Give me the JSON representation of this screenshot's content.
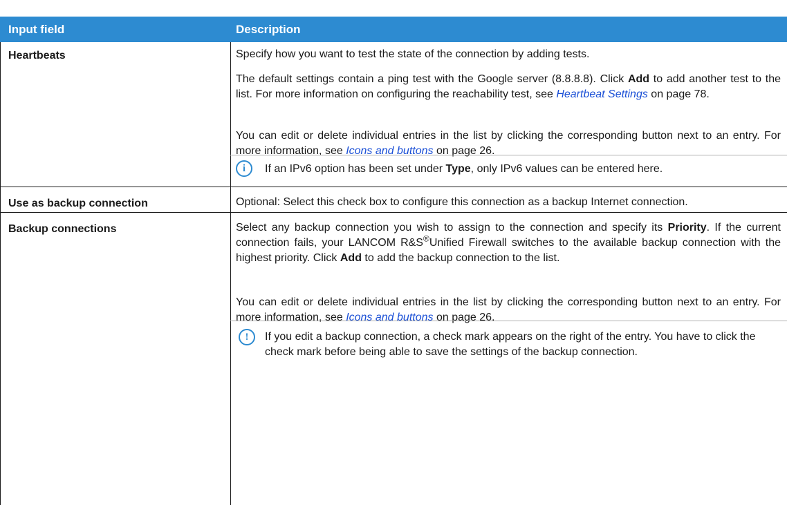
{
  "table": {
    "headers": [
      "Input field",
      "Description"
    ],
    "rows": {
      "heartbeats": {
        "field": "Heartbeats",
        "p1": "Specify how you want to test the state of the connection by adding tests.",
        "p2_a": "The default settings contain a ping test with the Google server (8.8.8.8). Click ",
        "p2_b": "Add",
        "p2_c": " to add another test to the list. For more information on configuring the reachability test, see ",
        "p2_link": "Heartbeat Settings",
        "p2_d": " on page 78.",
        "p3_a": "You can edit or delete individual entries in the list by clicking the corresponding button next to an entry. For more information, see ",
        "p3_link": "Icons and buttons",
        "p3_b": " on page 26.",
        "note_icon": "info-icon",
        "note_a": "If an IPv6 option has been set under ",
        "note_b": "Type",
        "note_c": ", only IPv6 values can be entered here."
      },
      "backup_use": {
        "field": "Use as backup connection",
        "p1": "Optional: Select this check box to configure this connection as a backup Internet connection."
      },
      "backup_connections": {
        "field": "Backup connections",
        "p1_a": "Select any backup connection you wish to assign to the connection and specify its ",
        "p1_b": "Priority",
        "p1_c": ". If the current connection fails, your LANCOM R&S",
        "p1_sup": "®",
        "p1_d": "Unified Firewall switches to the available backup connection with the highest priority. Click ",
        "p1_e": "Add",
        "p1_f": " to add the backup connection to the list.",
        "p2_a": "You can edit or delete individual entries in the list by clicking the corresponding button next to an entry. For more information, see ",
        "p2_link": "Icons and buttons",
        "p2_b": " on page 26.",
        "note_icon": "warning-icon",
        "note": "If you edit a backup connection, a check mark appears on the right of the entry. You have to click the check mark before being able to save the settings of the backup connection."
      }
    }
  },
  "colors": {
    "header_bg": "#2d8bd1",
    "link": "#1a4fd6",
    "icon": "#2d8bd1"
  }
}
